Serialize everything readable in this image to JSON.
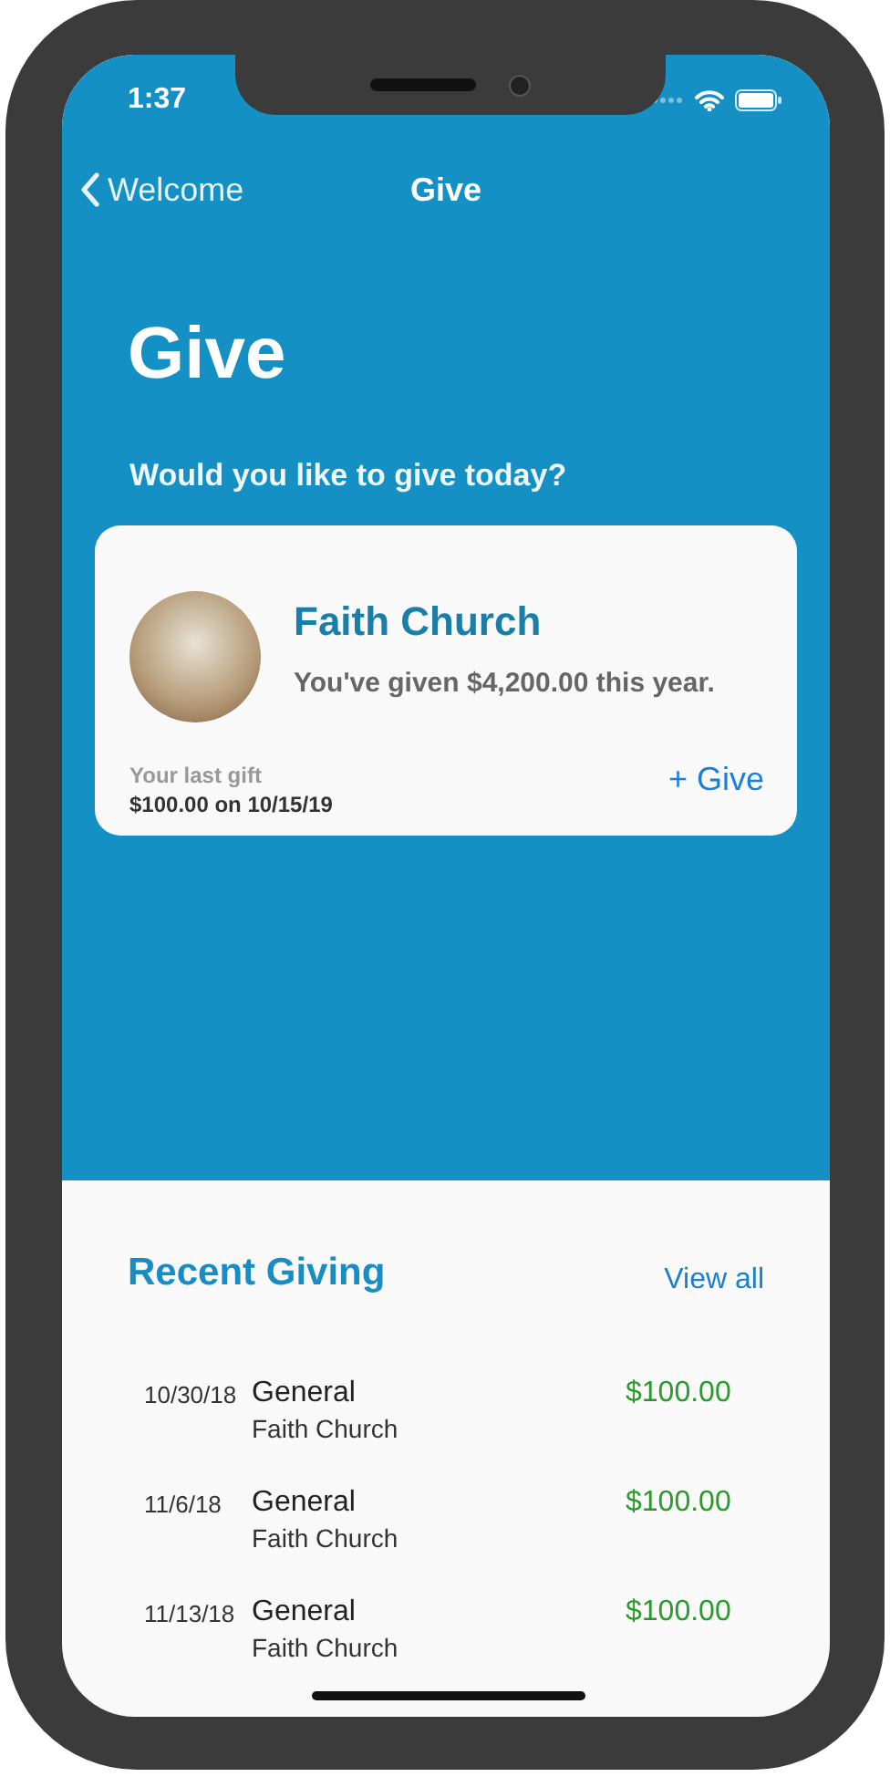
{
  "status_bar": {
    "time": "1:37"
  },
  "nav": {
    "back_label": "Welcome",
    "title": "Give"
  },
  "header": {
    "title": "Give",
    "prompt": "Would you like to give today?"
  },
  "card": {
    "name": "Faith Church",
    "summary": "You've given $4,200.00 this year.",
    "last_gift_label": "Your last gift",
    "last_gift_value": "$100.00 on 10/15/19",
    "give_button": "+ Give"
  },
  "recent": {
    "title": "Recent Giving",
    "view_all": "View all",
    "rows": [
      {
        "date": "10/30/18",
        "fund": "General",
        "church": "Faith Church",
        "amount": "$100.00"
      },
      {
        "date": "11/6/18",
        "fund": "General",
        "church": "Faith Church",
        "amount": "$100.00"
      },
      {
        "date": "11/13/18",
        "fund": "General",
        "church": "Faith Church",
        "amount": "$100.00"
      }
    ]
  }
}
